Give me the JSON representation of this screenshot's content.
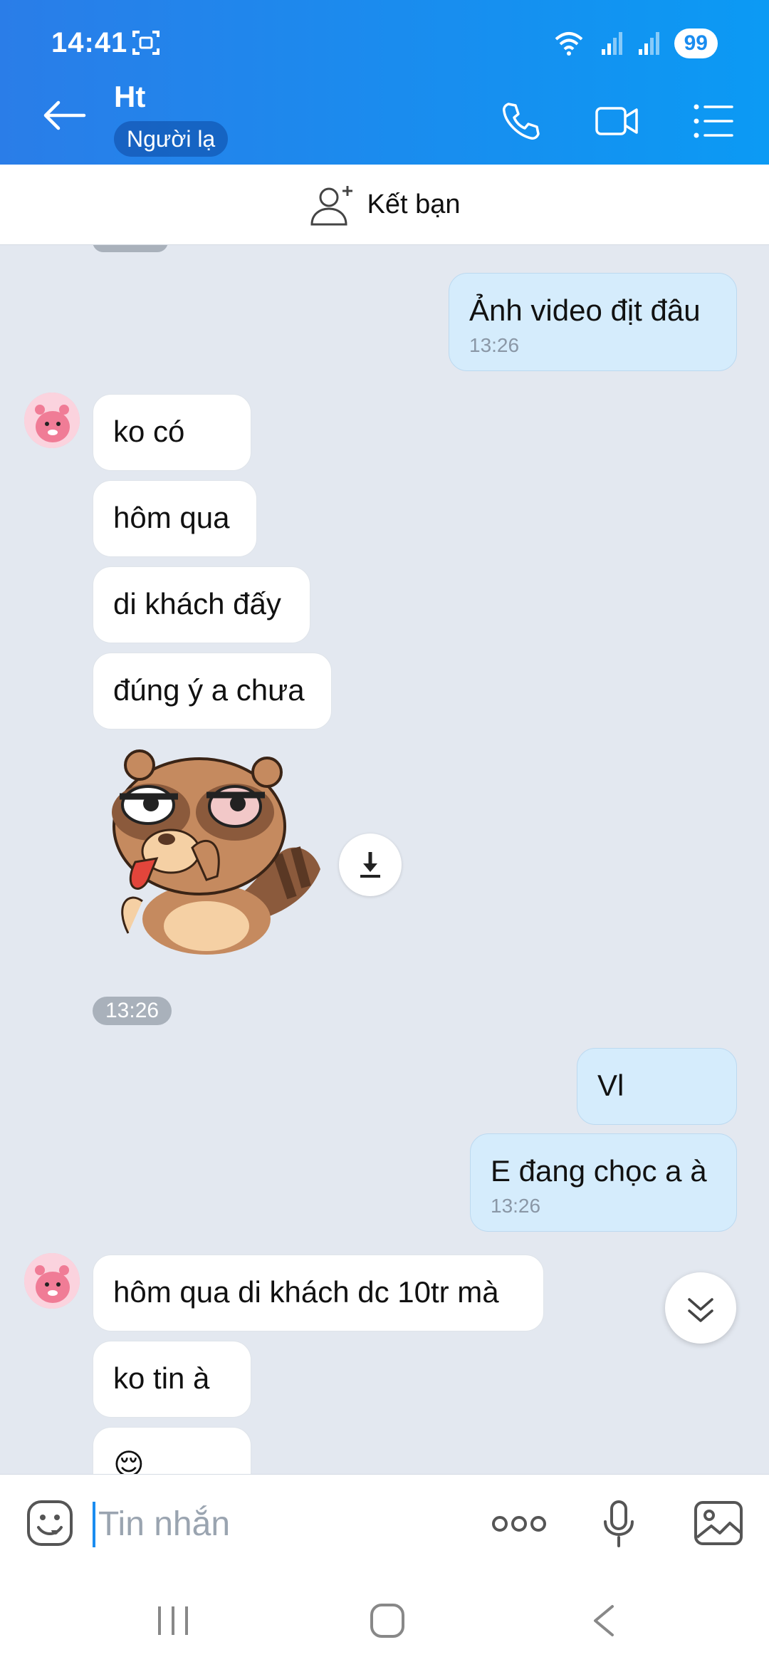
{
  "status": {
    "time": "14:41",
    "battery": "99"
  },
  "header": {
    "name": "Ht",
    "badge": "Người lạ"
  },
  "friend_bar": {
    "label": "Kết bạn"
  },
  "messages": [
    {
      "dir": "out",
      "text": "Ảnh video địt đâu",
      "time": "13:26"
    },
    {
      "dir": "in",
      "text": "ko có"
    },
    {
      "dir": "in",
      "text": "hôm qua"
    },
    {
      "dir": "in",
      "text": "di khách đấy"
    },
    {
      "dir": "in",
      "text": "đúng ý a chưa"
    },
    {
      "dir": "in",
      "sticker": "raccoon-sticker",
      "time": "13:26"
    },
    {
      "dir": "out",
      "text": "Vl"
    },
    {
      "dir": "out",
      "text": "E đang chọc a à",
      "time": "13:26"
    },
    {
      "dir": "in",
      "text": "hôm qua di khách dc 10tr mà"
    },
    {
      "dir": "in",
      "text": "ko tin à"
    },
    {
      "dir": "in",
      "text": "😌"
    }
  ],
  "input": {
    "placeholder": "Tin nhắn"
  },
  "colors": {
    "header_start": "#2a7de8",
    "header_end": "#0b9af4",
    "outgoing": "#d5ecfc",
    "incoming": "#ffffff",
    "background": "#e3e8f0"
  }
}
